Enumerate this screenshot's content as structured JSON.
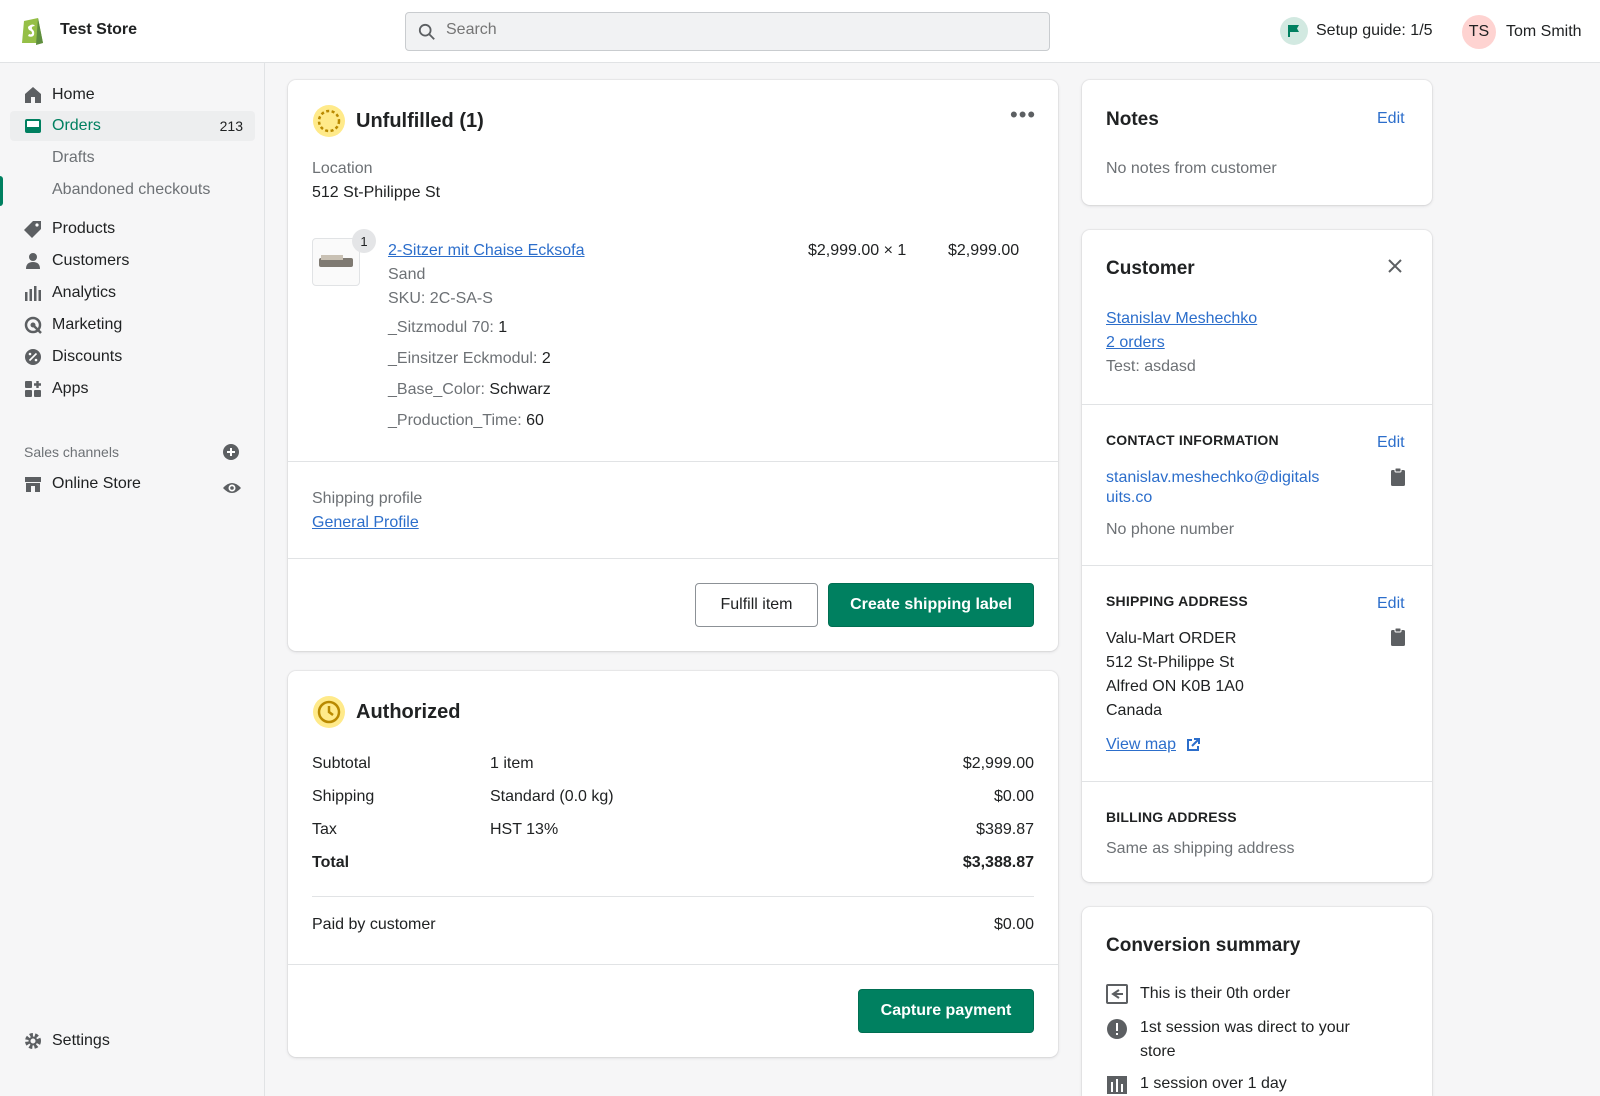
{
  "topbar": {
    "store_name": "Test Store",
    "search_placeholder": "Search",
    "setup_guide": "Setup guide: 1/5",
    "user_initials": "TS",
    "user_name": "Tom Smith"
  },
  "sidebar": {
    "items": [
      {
        "label": "Home",
        "icon": "home-icon"
      },
      {
        "label": "Orders",
        "icon": "orders-icon",
        "badge": "213"
      },
      {
        "label": "Products",
        "icon": "tag-icon"
      },
      {
        "label": "Customers",
        "icon": "person-icon"
      },
      {
        "label": "Analytics",
        "icon": "bar-chart-icon"
      },
      {
        "label": "Marketing",
        "icon": "marketing-icon"
      },
      {
        "label": "Discounts",
        "icon": "discount-icon"
      },
      {
        "label": "Apps",
        "icon": "apps-icon"
      }
    ],
    "orders_sub": [
      "Drafts",
      "Abandoned checkouts"
    ],
    "sales_channels_label": "Sales channels",
    "online_store": "Online Store",
    "settings": "Settings"
  },
  "unfulfilled": {
    "title": "Unfulfilled (1)",
    "location_label": "Location",
    "location_value": "512 St-Philippe St",
    "item": {
      "quantity_badge": "1",
      "name": "2-Sitzer mit Chaise Ecksofa",
      "variant": "Sand",
      "sku": "SKU: 2C-SA-S",
      "price_qty": "$2,999.00 × 1",
      "line_total": "$2,999.00",
      "properties": [
        {
          "key": "_Sitzmodul 70:",
          "value": "1"
        },
        {
          "key": "_Einsitzer Eckmodul:",
          "value": "2"
        },
        {
          "key": "_Base_Color:",
          "value": "Schwarz"
        },
        {
          "key": "_Production_Time:",
          "value": "60"
        }
      ]
    },
    "shipping_profile_label": "Shipping profile",
    "shipping_profile_link": "General Profile",
    "fulfill_button": "Fulfill item",
    "create_label_button": "Create shipping label"
  },
  "authorized": {
    "title": "Authorized",
    "rows": [
      {
        "label": "Subtotal",
        "detail": "1 item",
        "amount": "$2,999.00"
      },
      {
        "label": "Shipping",
        "detail": "Standard (0.0 kg)",
        "amount": "$0.00"
      },
      {
        "label": "Tax",
        "detail": "HST 13%",
        "amount": "$389.87"
      }
    ],
    "total_label": "Total",
    "total_amount": "$3,388.87",
    "paid_label": "Paid by customer",
    "paid_amount": "$0.00",
    "capture_button": "Capture payment"
  },
  "notes": {
    "title": "Notes",
    "edit": "Edit",
    "body": "No notes from customer"
  },
  "customer": {
    "title": "Customer",
    "name": "Stanislav Meshechko",
    "orders": "2 orders",
    "note": "Test: asdasd",
    "contact_heading": "CONTACT INFORMATION",
    "contact_edit": "Edit",
    "email_line1": "stanislav.meshechko@digitals",
    "email_line2": "uits.co",
    "phone": "No phone number",
    "shipping_heading": "SHIPPING ADDRESS",
    "shipping_edit": "Edit",
    "address": [
      "Valu-Mart ORDER",
      "512 St-Philippe St",
      "Alfred ON K0B 1A0",
      "Canada"
    ],
    "view_map": "View map",
    "billing_heading": "BILLING ADDRESS",
    "billing_value": "Same as shipping address"
  },
  "conversion": {
    "title": "Conversion summary",
    "line1": "This is their 0th order",
    "line2a": "1st session was direct to your",
    "line2b": "store",
    "line3": "1 session over 1 day"
  },
  "colors": {
    "primary_green": "#008060",
    "link_blue": "#2c6ecb",
    "status_yellow": "#ffc453"
  }
}
